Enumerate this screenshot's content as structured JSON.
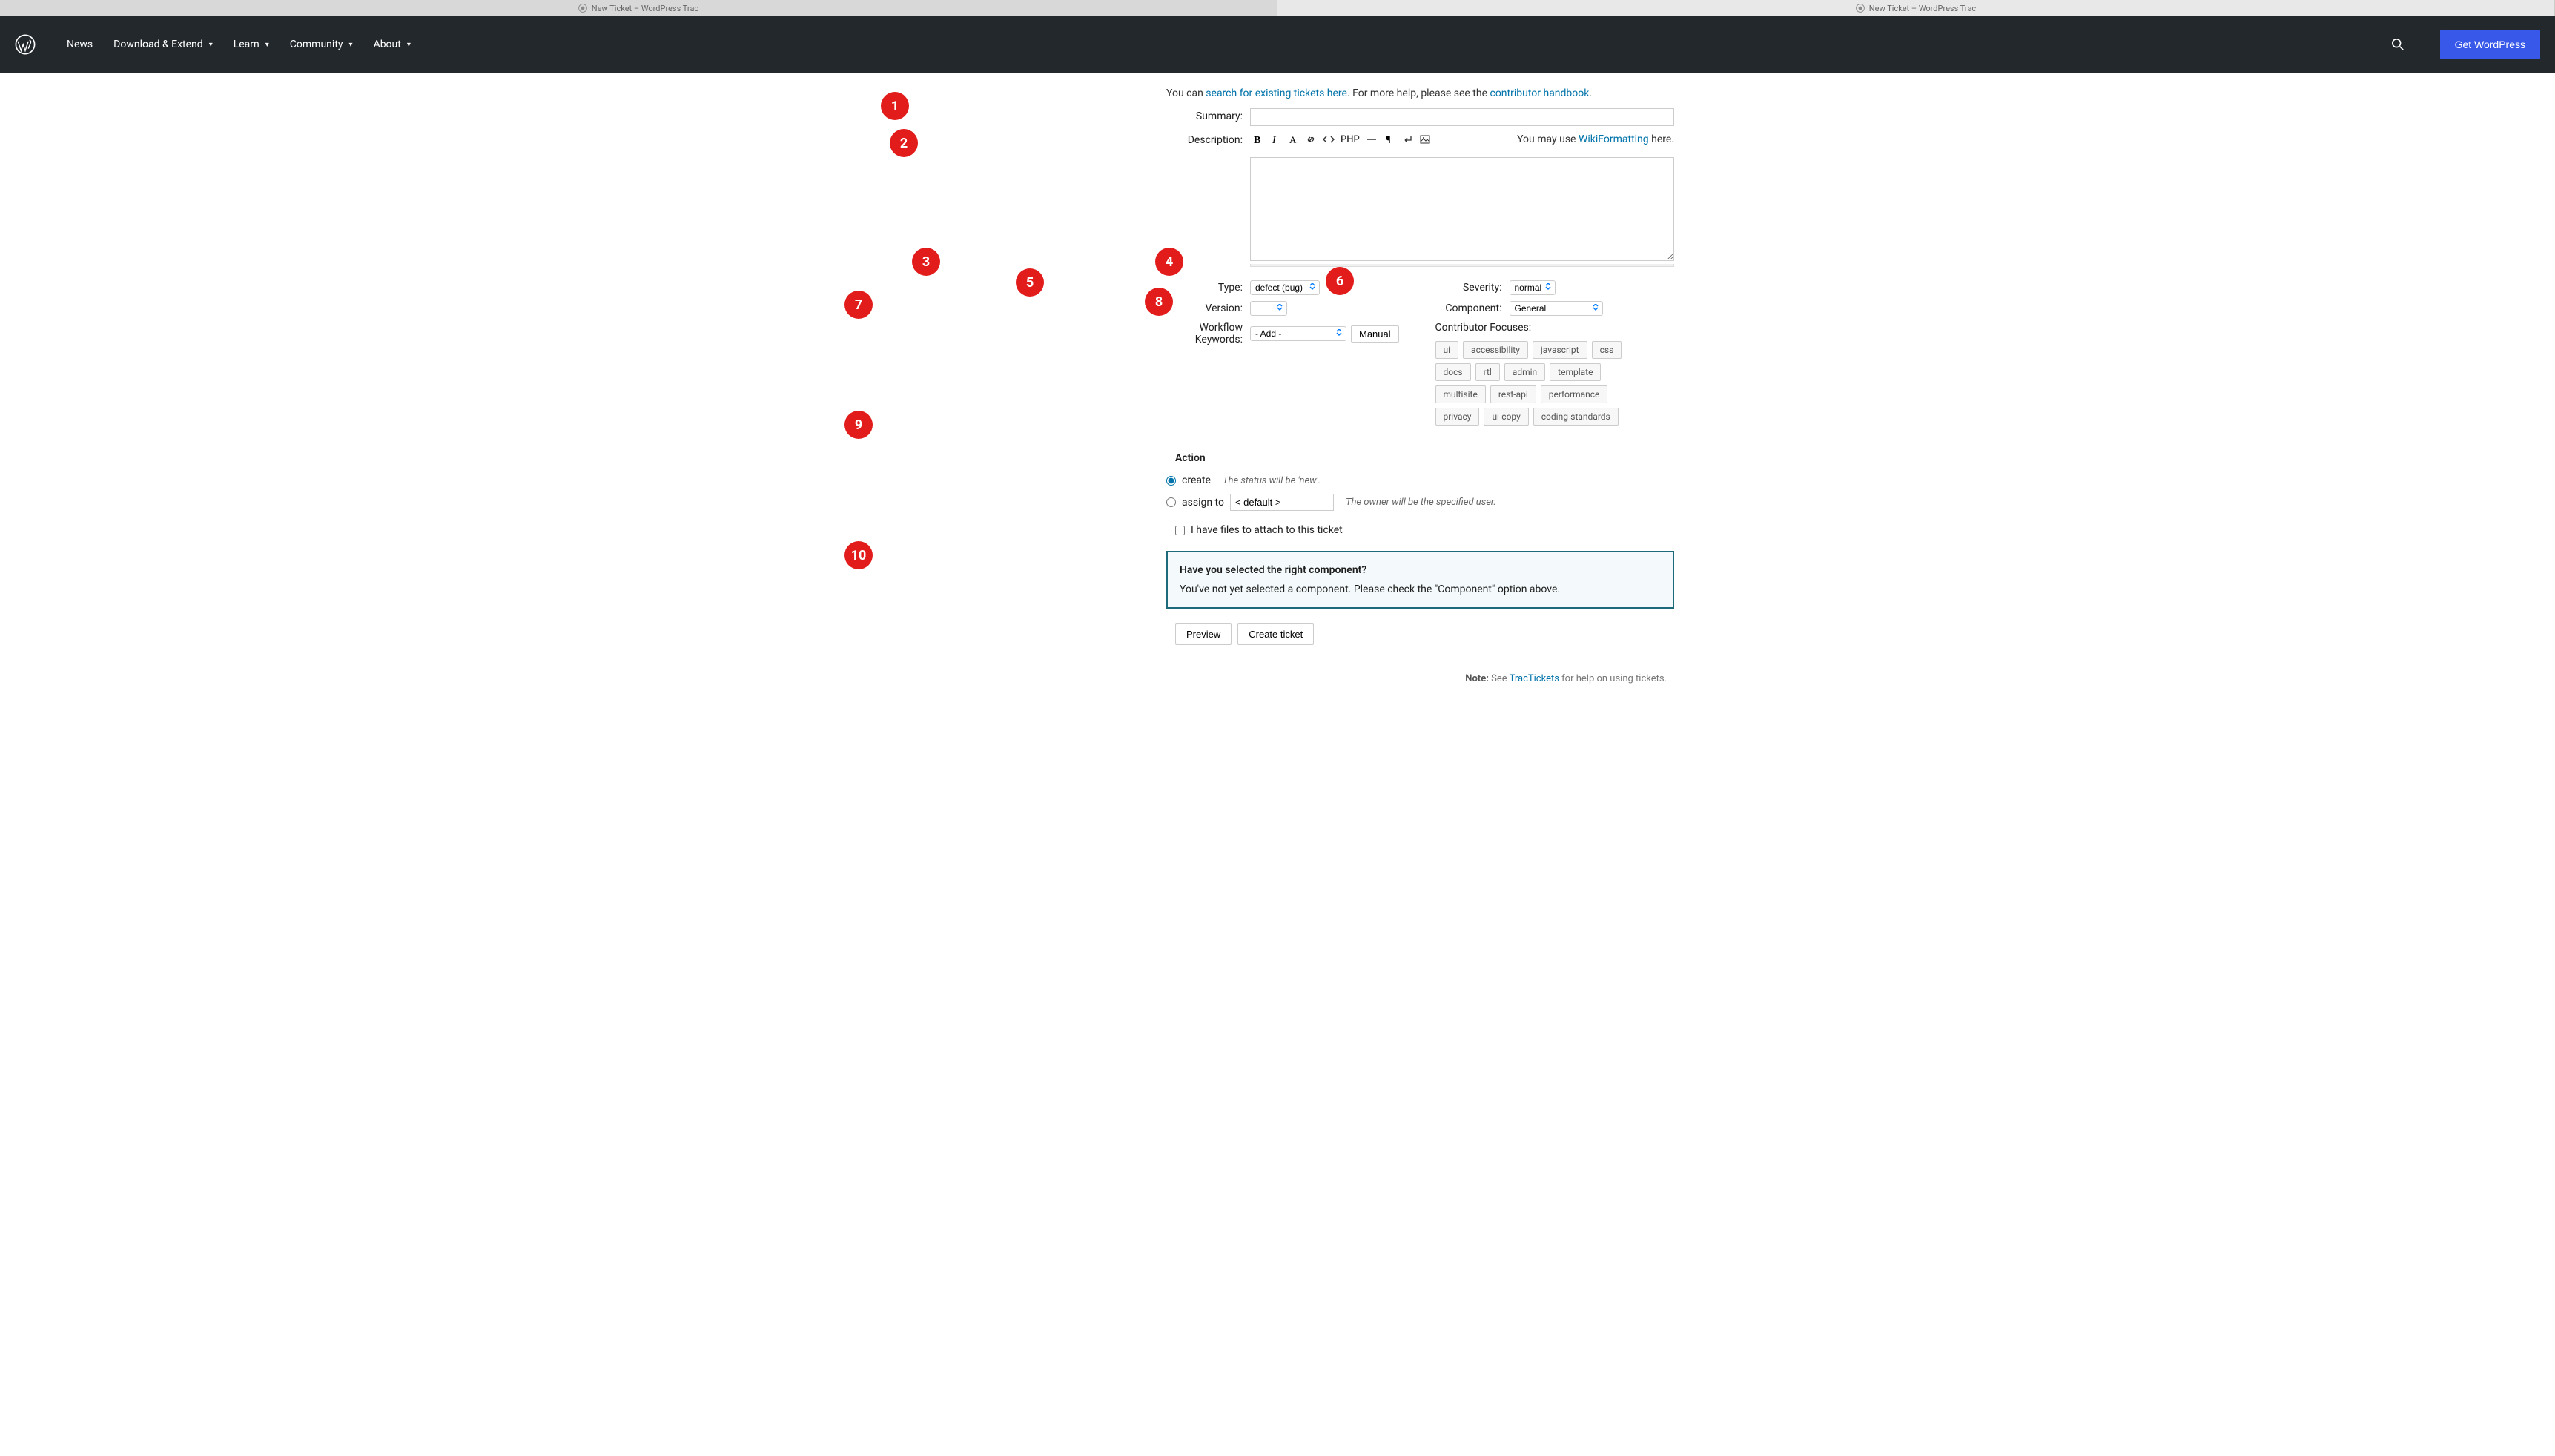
{
  "browser_tabs": [
    {
      "title": "New Ticket – WordPress Trac"
    },
    {
      "title": "New Ticket – WordPress Trac"
    }
  ],
  "header": {
    "nav": [
      "News",
      "Download & Extend",
      "Learn",
      "Community",
      "About"
    ],
    "cta": "Get WordPress"
  },
  "intro": {
    "prefix": "You can ",
    "link1": "search for existing tickets here",
    "middle": ". For more help, please see the ",
    "link2": "contributor handbook",
    "suffix": "."
  },
  "form": {
    "summary_label": "Summary:",
    "description_label": "Description:",
    "wiki_prefix": "You may use ",
    "wiki_link": "WikiFormatting",
    "wiki_suffix": " here.",
    "php_label": "PHP",
    "type_label": "Type:",
    "type_value": "defect (bug)",
    "version_label": "Version:",
    "version_value": "",
    "workflow_label": "Workflow Keywords:",
    "workflow_value": "- Add -",
    "manual": "Manual",
    "severity_label": "Severity:",
    "severity_value": "normal",
    "component_label": "Component:",
    "component_value": "General",
    "focuses_label": "Contributor Focuses:",
    "focuses": [
      "ui",
      "accessibility",
      "javascript",
      "css",
      "docs",
      "rtl",
      "admin",
      "template",
      "multisite",
      "rest-api",
      "performance",
      "privacy",
      "ui-copy",
      "coding-standards"
    ]
  },
  "action": {
    "heading": "Action",
    "create": "create",
    "create_note": "The status will be 'new'.",
    "assign": "assign to",
    "assign_placeholder": "< default >",
    "assign_note": "The owner will be the specified user.",
    "attach": "I have files to attach to this ticket"
  },
  "notice": {
    "title": "Have you selected the right component?",
    "text": "You've not yet selected a component. Please check the \"Component\" option above."
  },
  "submit": {
    "preview": "Preview",
    "create": "Create ticket"
  },
  "footer": {
    "note_label": "Note:",
    "prefix": " See ",
    "link": "TracTickets",
    "suffix": " for help on using tickets."
  },
  "badges": [
    "1",
    "2",
    "3",
    "4",
    "5",
    "6",
    "7",
    "8",
    "9",
    "10"
  ]
}
